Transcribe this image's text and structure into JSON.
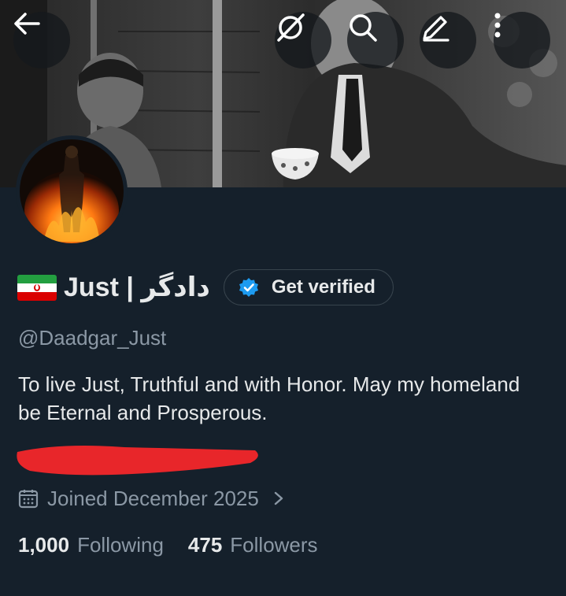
{
  "header": {
    "back_icon": "arrow-left-icon",
    "grok_icon": "grok-icon",
    "search_icon": "search-icon",
    "edit_icon": "pencil-icon",
    "more_icon": "more-vertical-icon"
  },
  "profile": {
    "flag_icon": "iran-flag-icon",
    "display_name": "Just | دادگر",
    "get_verified_label": "Get verified",
    "handle": "@Daadgar_Just",
    "bio": "To live Just, Truthful and with Honor.  May my homeland be Eternal and Prosperous.",
    "joined": "Joined December 2025",
    "following_count": "1,000",
    "following_label": "Following",
    "followers_count": "475",
    "followers_label": "Followers"
  },
  "colors": {
    "background": "#15202b",
    "text_primary": "#e7e9ea",
    "text_secondary": "#8b98a5",
    "verified_badge": "#1d9bf0",
    "redaction": "#e8262a"
  }
}
